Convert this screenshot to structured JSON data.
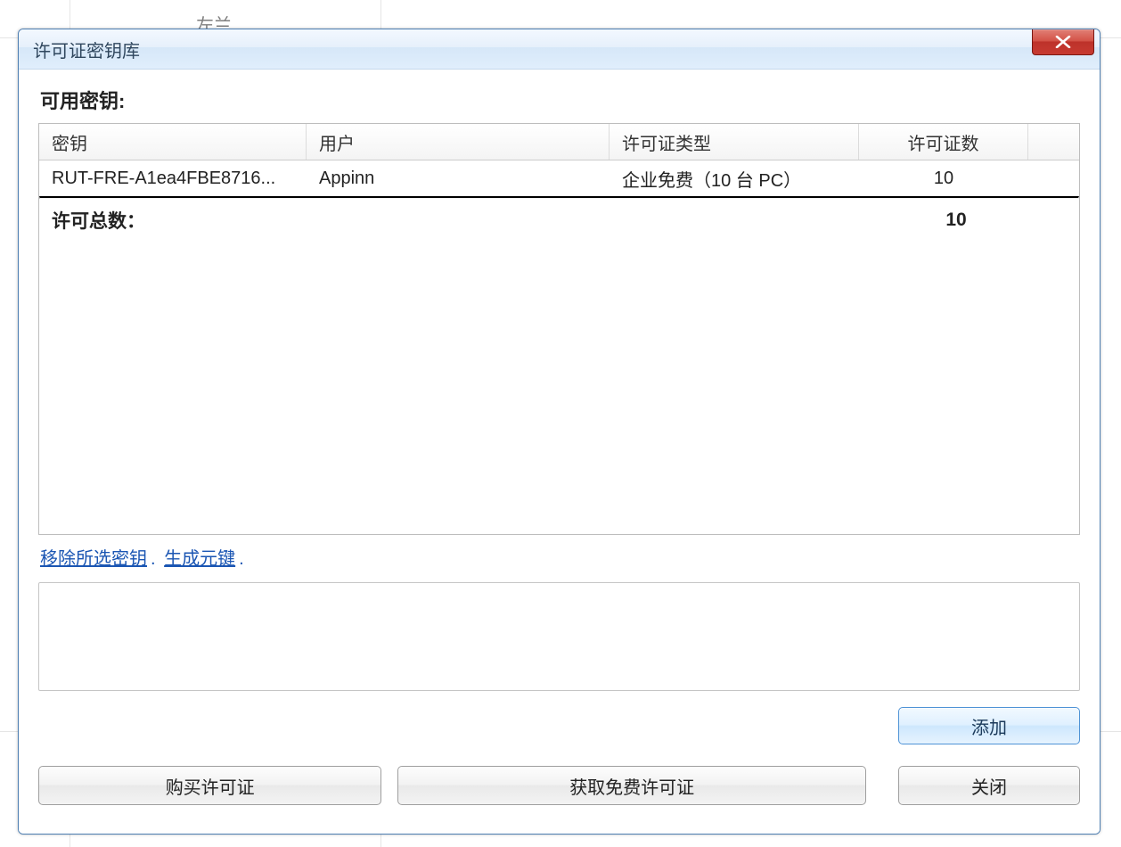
{
  "window": {
    "title": "许可证密钥库"
  },
  "section_label": "可用密钥:",
  "table": {
    "headers": {
      "key": "密钥",
      "user": "用户",
      "type": "许可证类型",
      "count": "许可证数"
    },
    "rows": [
      {
        "key": "RUT-FRE-A1ea4FBE8716...",
        "user": "Appinn",
        "type": "企业免费（10 台 PC）",
        "count": "10"
      }
    ],
    "total_label": "许可总数：",
    "total_value": "10"
  },
  "links": {
    "remove": "移除所选密钥",
    "generate": "生成元键",
    "trailing": "."
  },
  "textarea": {
    "value": ""
  },
  "buttons": {
    "add": "添加",
    "buy": "购买许可证",
    "get_free": "获取免费许可证",
    "close": "关闭"
  },
  "background_hint": "左兰"
}
